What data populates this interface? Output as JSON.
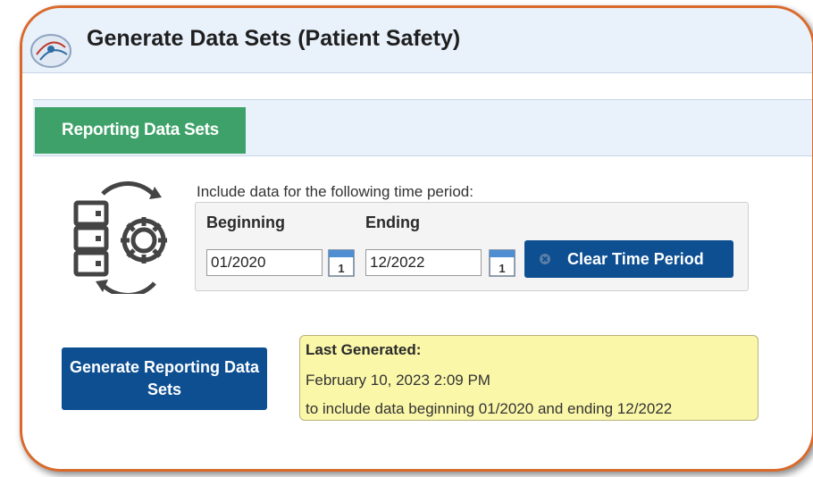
{
  "page": {
    "title": "Generate Data Sets (Patient Safety)"
  },
  "tabs": [
    {
      "label": "Reporting Data Sets",
      "active": true
    }
  ],
  "time_period": {
    "instructions": "Include data for the following time period:",
    "beginning_label": "Beginning",
    "beginning_value": "01/2020",
    "ending_label": "Ending",
    "ending_value": "12/2022",
    "calendar_day": "1",
    "clear_button": "Clear Time Period"
  },
  "generate_button": "Generate Reporting Data Sets",
  "last_generated": {
    "label": "Last Generated:",
    "datetime": "February 10, 2023 2:09 PM",
    "description": "to include data beginning 01/2020 and ending 12/2022"
  },
  "colors": {
    "frame_border": "#d96a2b",
    "header_bg": "#e9f1fb",
    "tab_active": "#3fa16a",
    "button_primary": "#0d4f91",
    "info_box": "#fbf7a9"
  },
  "icons": {
    "app": "app-logo-icon",
    "illustration": "server-gear-sync-icon",
    "calendar": "calendar-icon",
    "clear": "close-icon"
  }
}
